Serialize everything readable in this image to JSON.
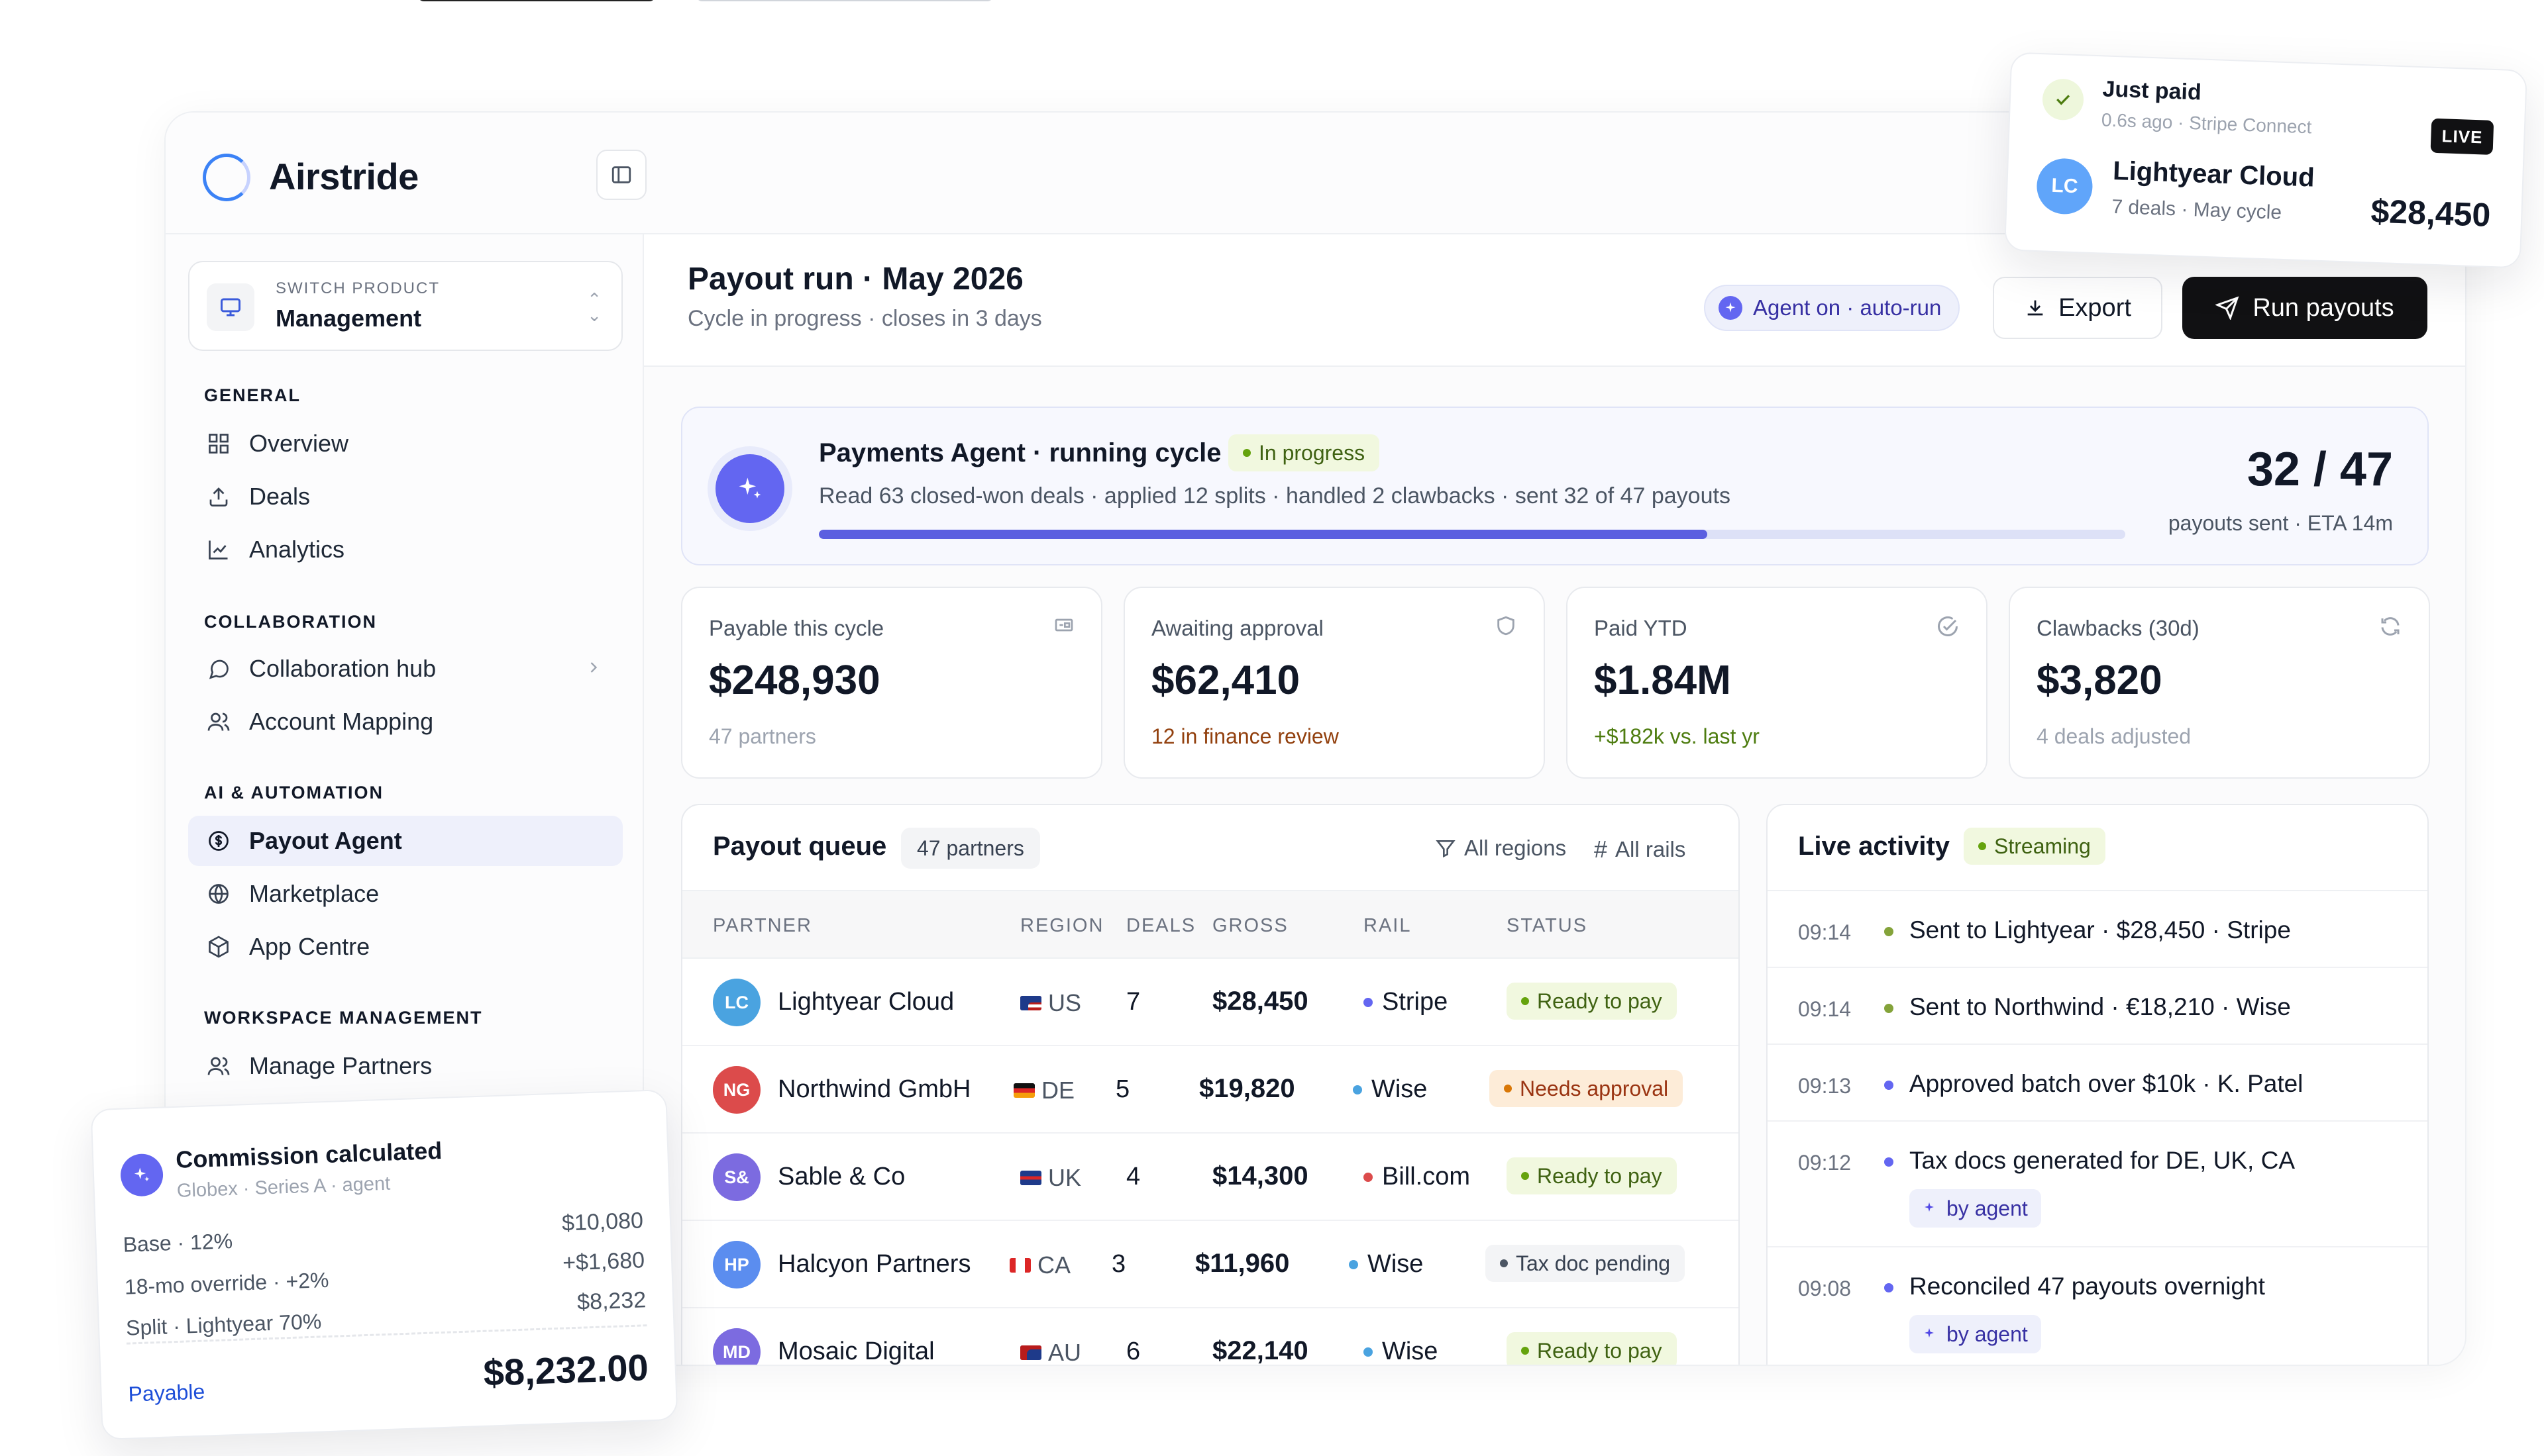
{
  "brand": {
    "name": "Airstride"
  },
  "switcher": {
    "caption": "SWITCH PRODUCT",
    "value": "Management"
  },
  "sidebar": {
    "sections": [
      {
        "title": "GENERAL",
        "items": [
          {
            "label": "Overview",
            "icon": "grid-icon"
          },
          {
            "label": "Deals",
            "icon": "upload-icon"
          },
          {
            "label": "Analytics",
            "icon": "chart-line-icon"
          }
        ]
      },
      {
        "title": "COLLABORATION",
        "items": [
          {
            "label": "Collaboration hub",
            "icon": "chat-icon"
          },
          {
            "label": "Account Mapping",
            "icon": "users-icon"
          }
        ]
      },
      {
        "title": "AI & AUTOMATION",
        "items": [
          {
            "label": "Payout Agent",
            "icon": "coin-icon",
            "active": true
          },
          {
            "label": "Marketplace",
            "icon": "globe-icon"
          },
          {
            "label": "App Centre",
            "icon": "cube-icon"
          }
        ]
      },
      {
        "title": "WORKSPACE MANAGEMENT",
        "items": [
          {
            "label": "Manage Partners",
            "icon": "users-icon"
          }
        ]
      }
    ]
  },
  "header": {
    "title": "Payout run · May 2026",
    "subtitle": "Cycle in progress · closes in 3 days",
    "agent_pill": "Agent on · auto-run",
    "export_label": "Export",
    "run_label": "Run payouts"
  },
  "agent_card": {
    "title": "Payments Agent · running cycle",
    "status": "In progress",
    "description": "Read 63 closed-won deals · applied 12 splits · handled 2 clawbacks · sent 32 of 47 payouts",
    "progress": 0.68,
    "count": "32 / 47",
    "count_sub": "payouts sent · ETA 14m"
  },
  "stats": [
    {
      "label": "Payable this cycle",
      "value": "$248,930",
      "sub": "47 partners",
      "icon": "wallet-icon",
      "tone": "muted"
    },
    {
      "label": "Awaiting approval",
      "value": "$62,410",
      "sub": "12 in finance review",
      "icon": "shield-icon",
      "tone": "amber"
    },
    {
      "label": "Paid YTD",
      "value": "$1.84M",
      "sub": "+$182k vs. last yr",
      "icon": "check-circle-icon",
      "tone": "green"
    },
    {
      "label": "Clawbacks (30d)",
      "value": "$3,820",
      "sub": "4 deals adjusted",
      "icon": "refresh-icon",
      "tone": "muted"
    }
  ],
  "queue": {
    "title": "Payout queue",
    "count": "47 partners",
    "filter_regions": "All regions",
    "filter_rails": "All rails",
    "columns": [
      "PARTNER",
      "REGION",
      "DEALS",
      "GROSS",
      "RAIL",
      "STATUS"
    ],
    "rows": [
      {
        "initials": "LC",
        "avatar_color": "#4aa3e0",
        "name": "Lightyear Cloud",
        "region": "US",
        "deals": "7",
        "gross": "$28,450",
        "rail": "Stripe",
        "rail_color": "#6366f1",
        "status": "Ready to pay",
        "status_tone": "green"
      },
      {
        "initials": "NG",
        "avatar_color": "#dc4b4b",
        "name": "Northwind GmbH",
        "region": "DE",
        "deals": "5",
        "gross": "$19,820",
        "rail": "Wise",
        "rail_color": "#4aa3e0",
        "status": "Needs approval",
        "status_tone": "amber"
      },
      {
        "initials": "S&",
        "avatar_color": "#7c6be0",
        "name": "Sable & Co",
        "region": "UK",
        "deals": "4",
        "gross": "$14,300",
        "rail": "Bill.com",
        "rail_color": "#dc4b4b",
        "status": "Ready to pay",
        "status_tone": "green"
      },
      {
        "initials": "HP",
        "avatar_color": "#5b8def",
        "name": "Halcyon Partners",
        "region": "CA",
        "deals": "3",
        "gross": "$11,960",
        "rail": "Wise",
        "rail_color": "#4aa3e0",
        "status": "Tax doc pending",
        "status_tone": "gray"
      },
      {
        "initials": "MD",
        "avatar_color": "#7c6be0",
        "name": "Mosaic Digital",
        "region": "AU",
        "deals": "6",
        "gross": "$22,140",
        "rail": "Wise",
        "rail_color": "#4aa3e0",
        "status": "Ready to pay",
        "status_tone": "green"
      }
    ]
  },
  "activity": {
    "title": "Live activity",
    "status": "Streaming",
    "by_agent": "by agent",
    "rows": [
      {
        "time": "09:14",
        "text": "Sent to Lightyear · $28,450 · Stripe",
        "dot": "#84a33a",
        "agent": false
      },
      {
        "time": "09:14",
        "text": "Sent to Northwind · €18,210 · Wise",
        "dot": "#84a33a",
        "agent": false
      },
      {
        "time": "09:13",
        "text": "Approved batch over $10k · K. Patel",
        "dot": "#6366f1",
        "agent": false
      },
      {
        "time": "09:12",
        "text": "Tax docs generated for DE, UK, CA",
        "dot": "#6366f1",
        "agent": true
      },
      {
        "time": "09:08",
        "text": "Reconciled 47 payouts overnight",
        "dot": "#6366f1",
        "agent": true
      }
    ]
  },
  "paid_toast": {
    "title": "Just paid",
    "meta": "0.6s ago · Stripe Connect",
    "live": "LIVE",
    "initials": "LC",
    "partner": "Lightyear Cloud",
    "detail": "7 deals · May cycle",
    "amount": "$28,450"
  },
  "commission_card": {
    "title": "Commission calculated",
    "meta": "Globex · Series A · agent",
    "lines": [
      {
        "label": "Base · 12%",
        "value": "$10,080"
      },
      {
        "label": "18-mo override · +2%",
        "value": "+$1,680"
      },
      {
        "label": "Split · Lightyear 70%",
        "value": "$8,232"
      }
    ],
    "status": "Payable",
    "total": "$8,232.00"
  }
}
